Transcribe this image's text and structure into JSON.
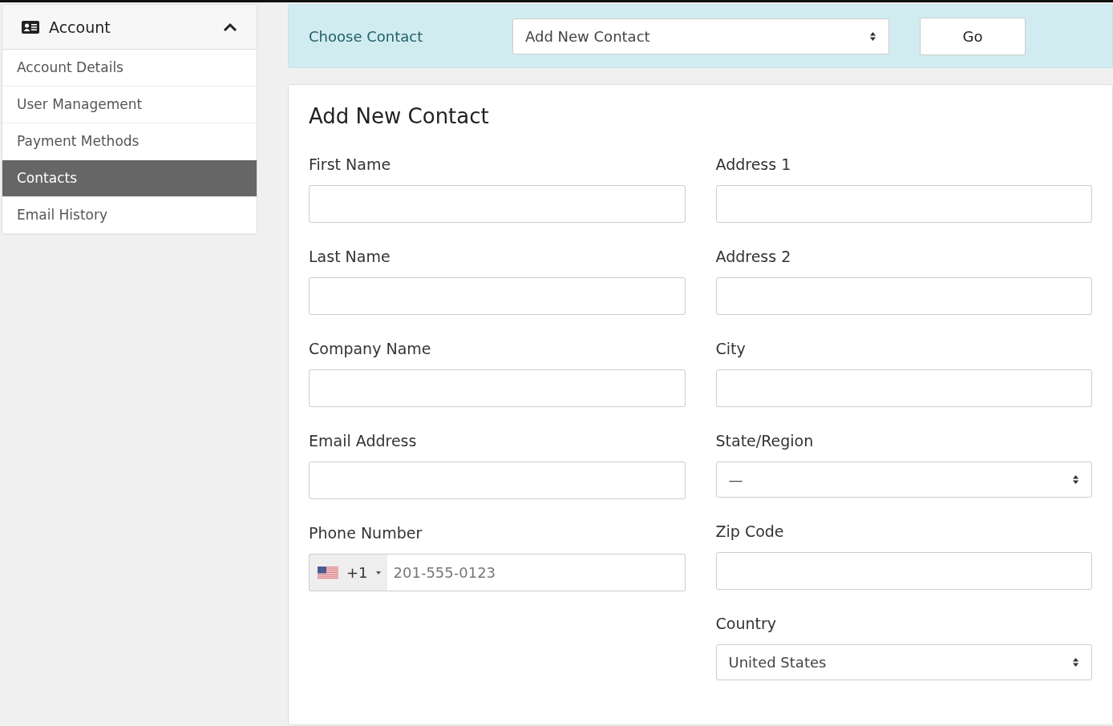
{
  "sidebar": {
    "title": "Account",
    "expanded": true,
    "items": [
      {
        "label": "Account Details",
        "selected": false
      },
      {
        "label": "User Management",
        "selected": false
      },
      {
        "label": "Payment Methods",
        "selected": false
      },
      {
        "label": "Contacts",
        "selected": true
      },
      {
        "label": "Email History",
        "selected": false
      }
    ]
  },
  "chooser": {
    "label": "Choose Contact",
    "value": "Add New Contact",
    "button": "Go"
  },
  "form": {
    "title": "Add New Contact",
    "columns": [
      [
        {
          "kind": "text",
          "label": "First Name"
        },
        {
          "kind": "text",
          "label": "Last Name"
        },
        {
          "kind": "text",
          "label": "Company Name"
        },
        {
          "kind": "text",
          "label": "Email Address"
        },
        {
          "kind": "phone",
          "label": "Phone Number",
          "dial_code": "+1",
          "placeholder": "201-555-0123"
        }
      ],
      [
        {
          "kind": "text",
          "label": "Address 1"
        },
        {
          "kind": "text",
          "label": "Address 2"
        },
        {
          "kind": "text",
          "label": "City"
        },
        {
          "kind": "select",
          "label": "State/Region",
          "value": "—"
        },
        {
          "kind": "text",
          "label": "Zip Code"
        },
        {
          "kind": "select",
          "label": "Country",
          "value": "United States"
        }
      ]
    ]
  }
}
